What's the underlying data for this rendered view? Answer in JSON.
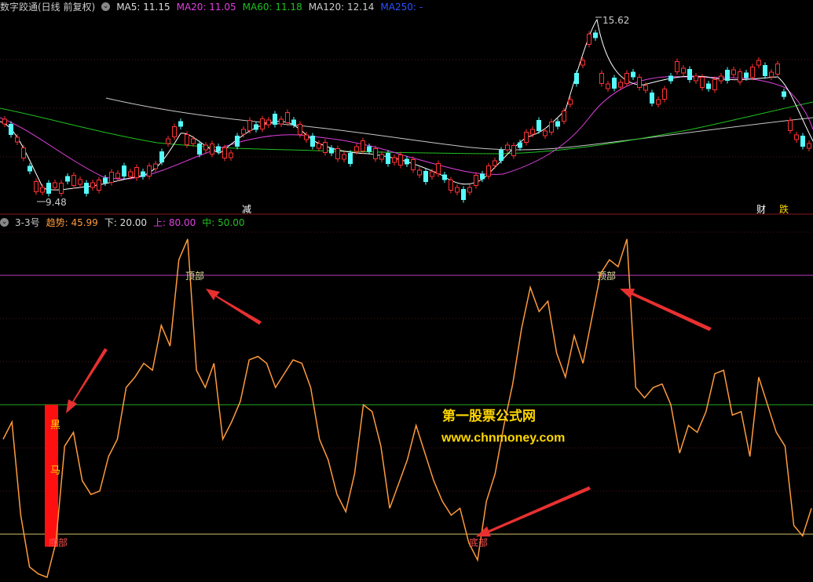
{
  "price_panel": {
    "title": "数字跤通(日线 前复权)",
    "ma5": "MA5: 11.15",
    "ma20": "MA20: 11.05",
    "ma60": "MA60: 11.18",
    "ma120": "MA120: 12.14",
    "ma250": "MA250: -",
    "high_label": "15.62",
    "low_label": "9.48",
    "markers": [
      "减",
      "财",
      "跌"
    ]
  },
  "indicator_panel": {
    "name": "3-3号",
    "trend": "趋势: 45.99",
    "lower": "下: 20.00",
    "upper": "上: 80.00",
    "mid": "中: 50.00",
    "top_label": "顶部",
    "bottom_label": "底部",
    "black_horse": [
      "黑",
      "马"
    ]
  },
  "watermark": {
    "name": "第一股票公式网",
    "url": "www.chnmoney.com"
  },
  "colors": {
    "up": "#ff3232",
    "down": "#54fcfc",
    "ma5": "#ffffff",
    "ma20": "#e040e0",
    "ma60": "#20c020",
    "ma120": "#c8c8c8",
    "trend": "#ff9a3c",
    "upper_line": "#c040c0",
    "mid_line": "#22aa22",
    "lower_line": "#d4c06a"
  },
  "chart_data": [
    {
      "type": "line",
      "series": [
        {
          "name": "趋势",
          "values": [
            40,
            45,
            18,
            3,
            1,
            0,
            10,
            38,
            42,
            28,
            24,
            25,
            35,
            40,
            55,
            58,
            62,
            60,
            73,
            67,
            92,
            98,
            60,
            55,
            62,
            40,
            45,
            51,
            63,
            64,
            62,
            55,
            59,
            63,
            62,
            55,
            40,
            34,
            24,
            19,
            30,
            50,
            48,
            38,
            20,
            27,
            34,
            44,
            36,
            28,
            22,
            18,
            20,
            10,
            5,
            22,
            30,
            44,
            56,
            72,
            84,
            77,
            80,
            65,
            58,
            70,
            62,
            75,
            88,
            92,
            90,
            98,
            55,
            52,
            55,
            56,
            50,
            36,
            44,
            42,
            48,
            59,
            60,
            47,
            48,
            35,
            58,
            50,
            42,
            38,
            15,
            12,
            20
          ]
        }
      ],
      "ylim": [
        0,
        100
      ],
      "hlines": [
        80,
        50,
        20
      ]
    }
  ]
}
